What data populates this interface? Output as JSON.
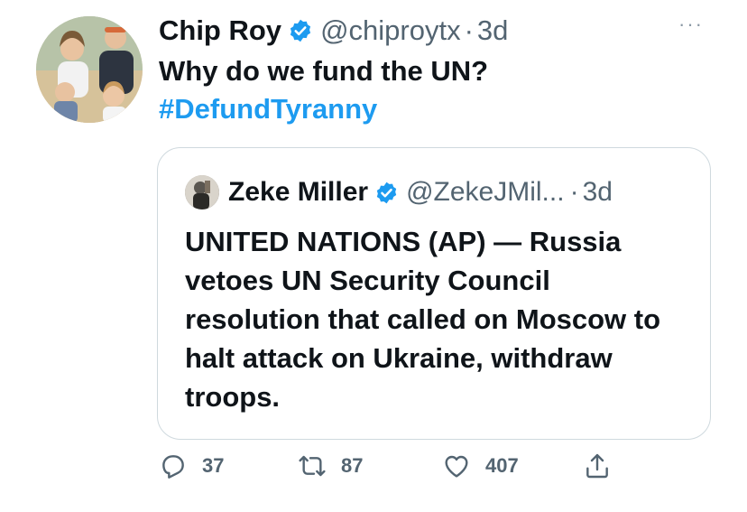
{
  "tweet": {
    "author_name": "Chip Roy",
    "author_handle": "@chiproytx",
    "separator": "·",
    "time": "3d",
    "more_label": "···",
    "text_line": "Why do we fund the UN?",
    "hashtag": "#DefundTyranny"
  },
  "quote": {
    "author_name": "Zeke Miller",
    "author_handle": "@ZekeJMil...",
    "separator": "·",
    "time": "3d",
    "text": "UNITED NATIONS (AP) — Russia vetoes UN Security Council resolution that called on Moscow to halt attack on Ukraine, withdraw troops."
  },
  "actions": {
    "replies": "37",
    "retweets": "87",
    "likes": "407"
  },
  "icons": {
    "verified": "verified-badge-icon",
    "reply": "reply-icon",
    "retweet": "retweet-icon",
    "like": "heart-icon",
    "share": "share-icon",
    "more": "more-icon"
  },
  "colors": {
    "brand_blue": "#1d9bf0",
    "secondary_text": "#536471",
    "border": "#cfd9de"
  }
}
